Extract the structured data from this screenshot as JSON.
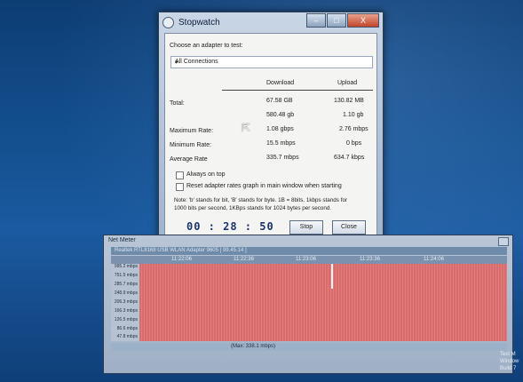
{
  "stopwatch": {
    "title": "Stopwatch",
    "window_buttons": {
      "minimize": "–",
      "maximize": "□",
      "close": "X"
    },
    "prompt_label": "Choose an adapter to test:",
    "adapter_selected": "All Connections",
    "col_download": "Download",
    "col_upload": "Upload",
    "rows": [
      {
        "label": "Total:",
        "download": "67.58 GB",
        "upload": "130.82 MB"
      },
      {
        "label": "",
        "download": "580.48 gb",
        "upload": "1.10 gb"
      },
      {
        "label": "Maximum Rate:",
        "download": "1.08 gbps",
        "upload": "2.76 mbps"
      },
      {
        "label": "Minimum Rate:",
        "download": "15.5 mbps",
        "upload": "0 bps"
      },
      {
        "label": "Average Rate",
        "download": "335.7 mbps",
        "upload": "634.7 kbps"
      }
    ],
    "always_on_top": "Always on top",
    "reset_graph": "Reset adapter rates graph in main window when starting",
    "note_line1": "Note: 'b' stands for bit, 'B' stands for byte.  1B = 8bits.  1kbps stands for",
    "note_line2": "1000 bits per second, 1KBps stands for 1024 bytes per second.",
    "timer": "00 : 28 : 50",
    "stop_label": "Stop",
    "close_label": "Close"
  },
  "netmeter": {
    "title": "Net Meter",
    "adapter_strip": "Realtek RTL8168 USB WLAN Adapter 9605 [ 99.45.14 ]",
    "times": [
      "11:22:06",
      "11:22:36",
      "11:23:06",
      "11:23:36",
      "11:24:06"
    ],
    "y_ticks": [
      "995.2 mbps",
      "751.5 mbps",
      "285.7 mbps",
      "248.9 mbps",
      "206.3 mbps",
      "166.3 mbps",
      "126.5 mbps",
      "86.6 mbps",
      "47.8 mbps"
    ],
    "footer": "(Max: 338.1 mbps)",
    "graph_level": 1.0
  },
  "system": {
    "line1": "Test M",
    "line2": "Window",
    "line3": "Build 7"
  }
}
